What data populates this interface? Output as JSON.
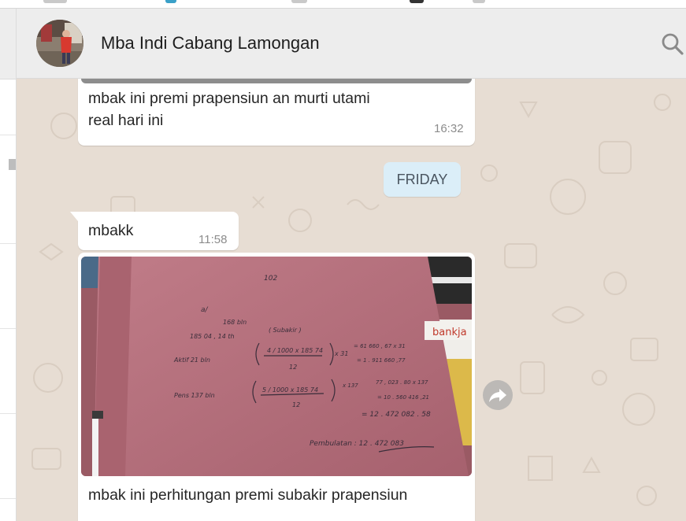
{
  "chat": {
    "contact_name": "Mba Indi Cabang Lamongan"
  },
  "messages": [
    {
      "text_line1": "mbak ini premi prapensiun an         murti utami",
      "text_line2": "real hari ini",
      "time": "16:32"
    },
    {
      "text": "mbakk",
      "time": "11:58"
    },
    {
      "caption": "mbak ini perhitungan premi subakir prapensiun"
    }
  ],
  "date_divider": "FRIDAY",
  "photo": {
    "sign_text": "bankja",
    "handwriting": [
      "102",
      "a/",
      "168 bln",
      "185 04 , 14 th",
      "( Subakir )",
      "Aktif   21 bln",
      "4 / 1000  x  185 74",
      "x 31",
      "= 61 660 , 67  x 31",
      "= 1 . 911 660 ,77",
      "12",
      "Pens     137 bln",
      "5 / 1000  x  185 74",
      "x 137",
      "77 , 023 . 80  x 137",
      "= 10 . 560 416 ,21",
      "12",
      "= 12 . 472 082 . 58",
      "Pembulatan :  12 . 472 083"
    ]
  },
  "icons": {
    "search": "search-icon",
    "forward": "forward-icon"
  },
  "colors": {
    "chat_background": "#e7ddd3",
    "bubble_incoming": "#ffffff",
    "date_chip": "#dbeef8",
    "header": "#ededed",
    "paper_pink": "#b77481"
  }
}
